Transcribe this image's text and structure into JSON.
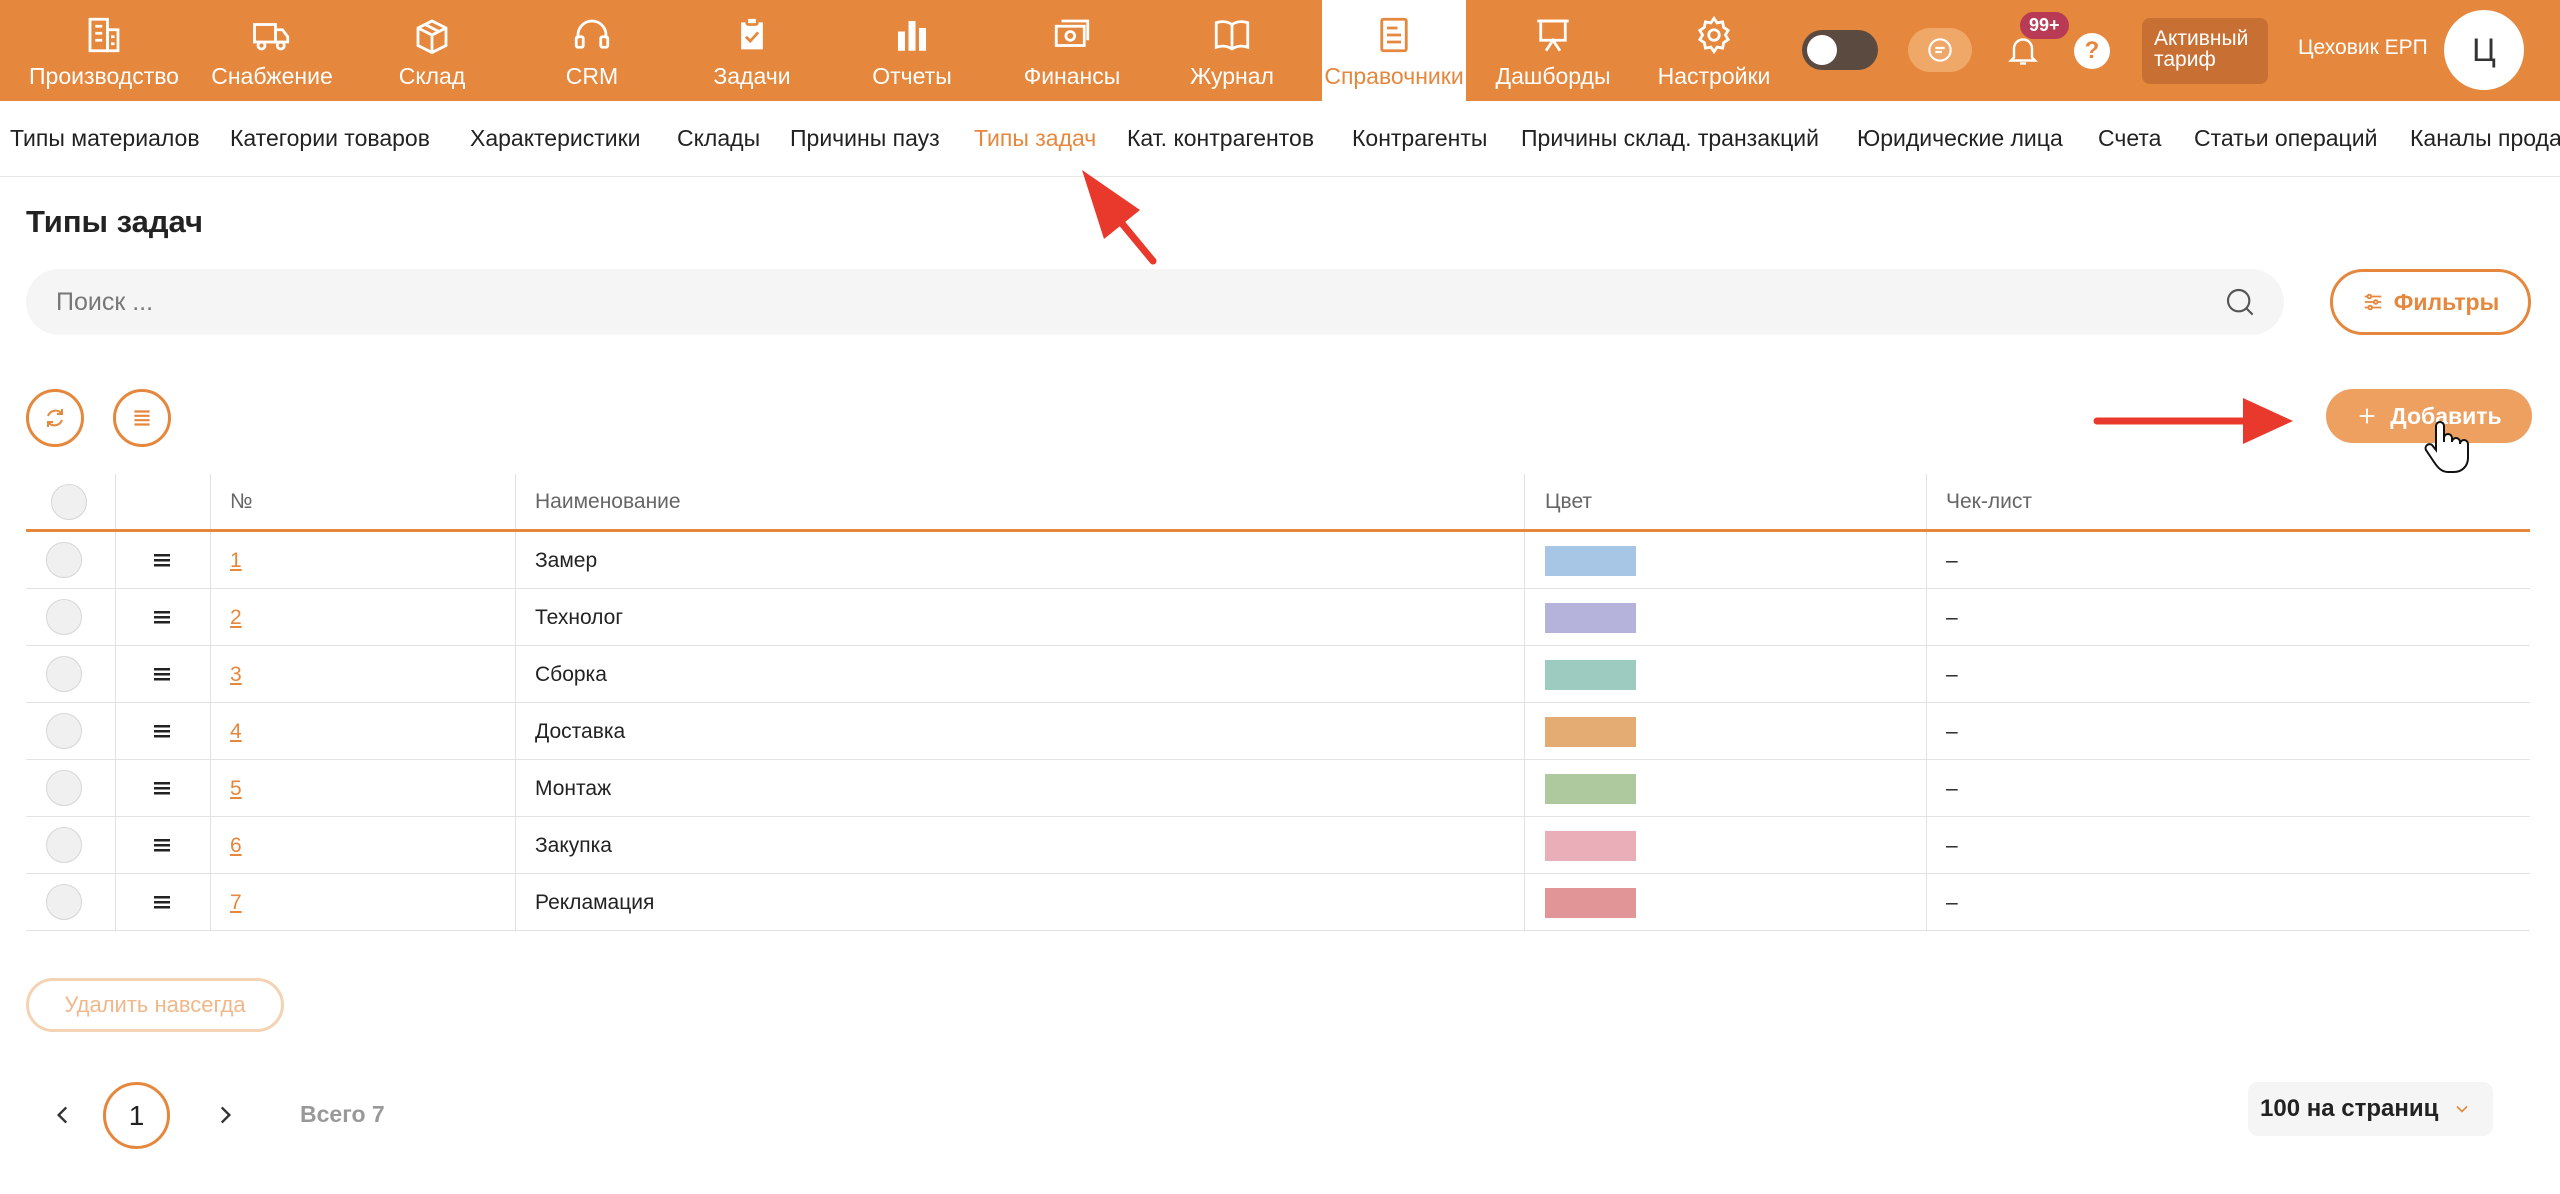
{
  "colors": {
    "accent": "#e5873c",
    "badge": "#b83a55",
    "arrow": "#e8392c"
  },
  "topnav": {
    "items": [
      {
        "label": "Производство",
        "icon": "building-icon"
      },
      {
        "label": "Снабжение",
        "icon": "truck-icon"
      },
      {
        "label": "Склад",
        "icon": "box-icon"
      },
      {
        "label": "CRM",
        "icon": "headset-icon"
      },
      {
        "label": "Задачи",
        "icon": "clipboard-check-icon"
      },
      {
        "label": "Отчеты",
        "icon": "bar-chart-icon"
      },
      {
        "label": "Финансы",
        "icon": "money-icon"
      },
      {
        "label": "Журнал",
        "icon": "book-icon"
      },
      {
        "label": "Справочники",
        "icon": "document-icon"
      },
      {
        "label": "Дашборды",
        "icon": "presentation-board-icon"
      },
      {
        "label": "Настройки",
        "icon": "gear-icon"
      }
    ],
    "active_index": 8,
    "notifications_badge": "99+",
    "help_label": "?",
    "tariff_label_line1": "Активный",
    "tariff_label_line2": "тариф",
    "company_name": "Цеховик ЕРП",
    "avatar_letter": "Ц"
  },
  "subnav": {
    "items": [
      "Типы материалов",
      "Категории товаров",
      "Характеристики",
      "Склады",
      "Причины пауз",
      "Типы задач",
      "Кат. контрагентов",
      "Контрагенты",
      "Причины склад. транзакций",
      "Юридические лица",
      "Счета",
      "Статьи операций",
      "Каналы прода"
    ],
    "active_index": 5
  },
  "page": {
    "title": "Типы задач",
    "search_placeholder": "Поиск ...",
    "filters_label": "Фильтры",
    "add_label": "Добавить",
    "delete_label": "Удалить навсегда"
  },
  "table": {
    "headers": {
      "num": "№",
      "name": "Наименование",
      "color": "Цвет",
      "checklist": "Чек-лист"
    },
    "rows": [
      {
        "num": "1",
        "name": "Замер",
        "color": "#a7c6e6",
        "checklist": "–"
      },
      {
        "num": "2",
        "name": "Технолог",
        "color": "#b5b3dc",
        "checklist": "–"
      },
      {
        "num": "3",
        "name": "Сборка",
        "color": "#9dcbc0",
        "checklist": "–"
      },
      {
        "num": "4",
        "name": "Доставка",
        "color": "#e4ab72",
        "checklist": "–"
      },
      {
        "num": "5",
        "name": "Монтаж",
        "color": "#adc99d",
        "checklist": "–"
      },
      {
        "num": "6",
        "name": "Закупка",
        "color": "#e9aeb8",
        "checklist": "–"
      },
      {
        "num": "7",
        "name": "Рекламация",
        "color": "#e29596",
        "checklist": "–"
      }
    ]
  },
  "pagination": {
    "current_page": "1",
    "total_label": "Всего 7",
    "per_page_label": "100 на страниц"
  }
}
